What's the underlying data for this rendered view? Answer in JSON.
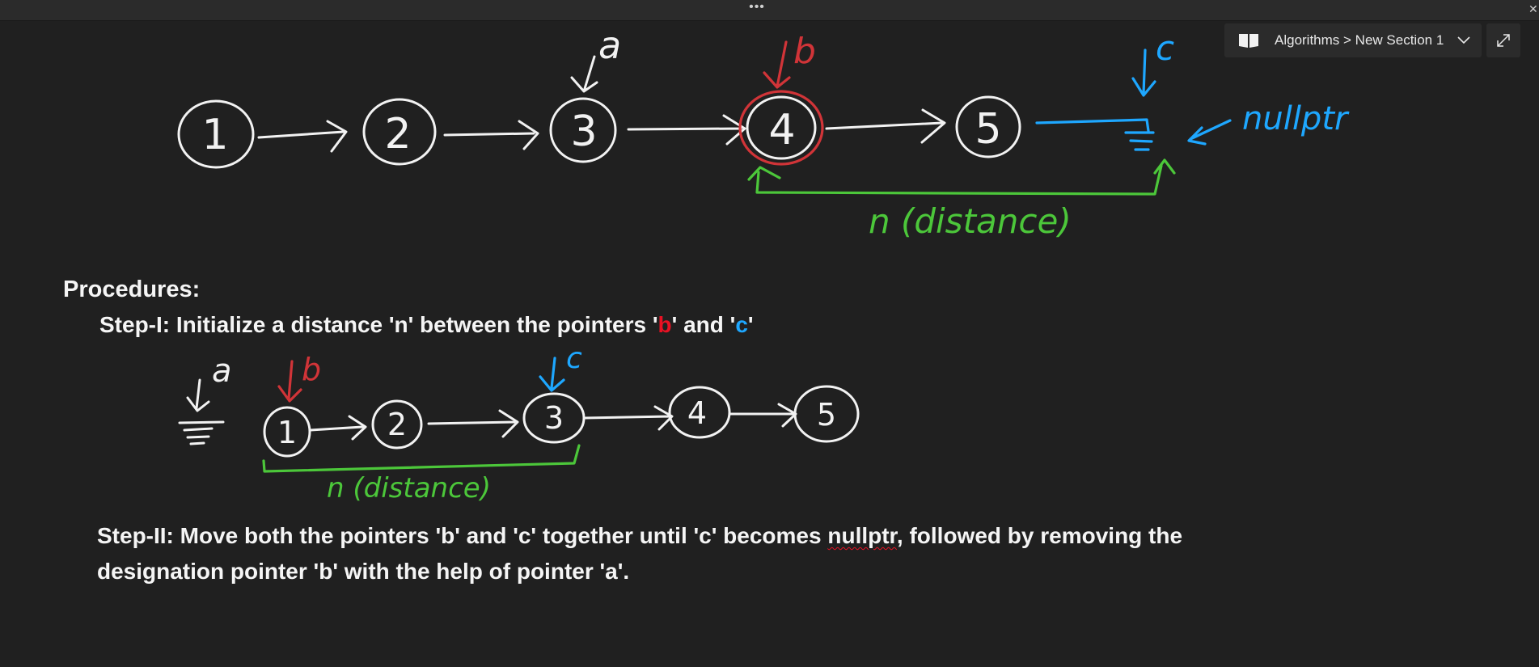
{
  "window": {
    "drag_handle": "•••",
    "close_glyph": "✕"
  },
  "header": {
    "breadcrumb": "Algorithms > New Section 1",
    "icons": [
      "notebook-icon",
      "chevron-down-icon",
      "expand-icon"
    ]
  },
  "diagram_top": {
    "nodes": [
      "1",
      "2",
      "3",
      "4",
      "5"
    ],
    "pointer_a": "a",
    "pointer_b": "b",
    "pointer_c": "c",
    "null_label": "nullptr",
    "distance_label": "n (distance)"
  },
  "diagram_step1": {
    "nodes": [
      "1",
      "2",
      "3",
      "4",
      "5"
    ],
    "pointer_a": "a",
    "pointer_b": "b",
    "pointer_c": "c",
    "distance_label": "n (distance)"
  },
  "text": {
    "procedures": "Procedures:",
    "step1_prefix": "Step-I: Initialize a distance 'n' between the pointers '",
    "step1_b": "b",
    "step1_mid": "' and '",
    "step1_c": "c",
    "step1_end": "'",
    "step2_line1_prefix": "Step-II: Move both the pointers 'b' and 'c' together until 'c' becomes ",
    "step2_line1_nullptr": "nullptr",
    "step2_line1_suffix": ", followed by removing the",
    "step2_line2": "designation pointer 'b' with the help of pointer 'a'."
  },
  "colors": {
    "background": "#202020",
    "ink_white": "#f2f2f2",
    "ink_red": "#d13438",
    "ink_blue": "#1ea7ff",
    "ink_green": "#4cc73a",
    "text_red": "#e81123",
    "text_blue": "#1ea7ff"
  }
}
